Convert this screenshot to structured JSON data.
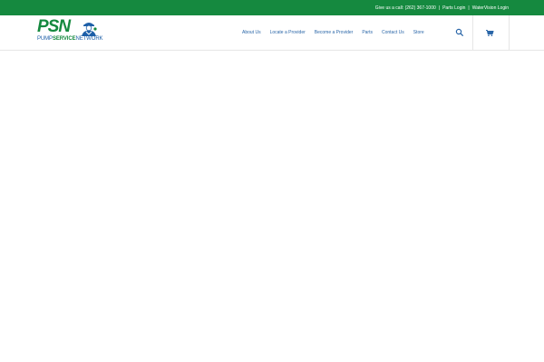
{
  "topbar": {
    "phone": "Give us a call: (262) 367-1000",
    "links": [
      "Parts Login",
      "WaterVision Login"
    ],
    "separator": "|"
  },
  "logo": {
    "mark": "PSN",
    "word_pump": "PUMP",
    "word_service": "SERVICE",
    "word_network": "NETWORK"
  },
  "nav": {
    "items": [
      "About Us",
      "Locate a Provider",
      "Become a Provider",
      "Parts",
      "Contact Us",
      "Store"
    ]
  },
  "icons": {
    "search": "search-icon",
    "cart": "cart-icon"
  },
  "colors": {
    "brand_green": "#15893f",
    "brand_blue": "#1d5fa8",
    "nav_text": "#2a66a8"
  }
}
